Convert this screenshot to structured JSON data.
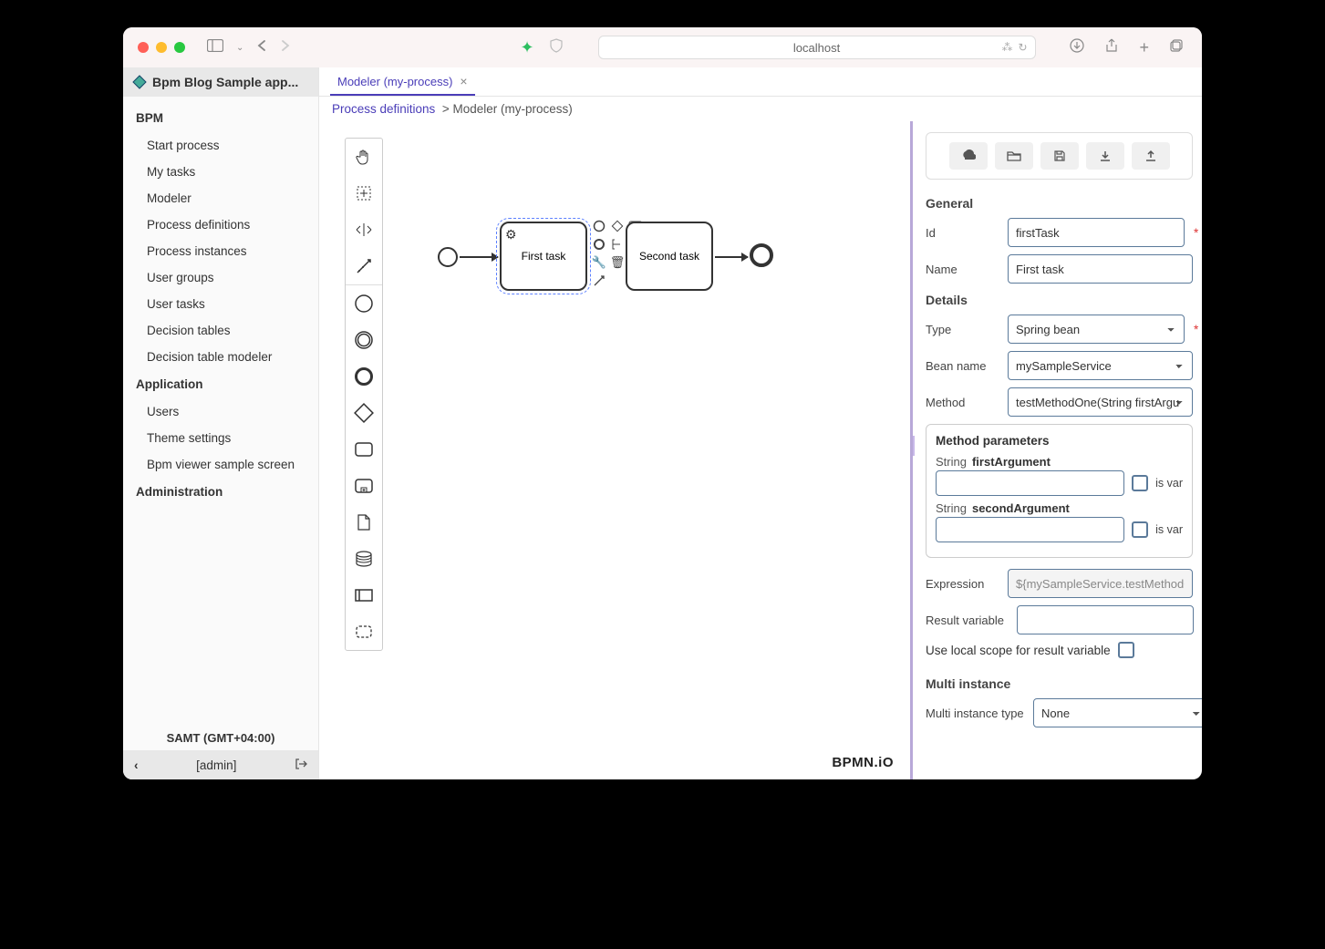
{
  "browser": {
    "address": "localhost"
  },
  "app_title": "Bpm Blog Sample app...",
  "sidebar": {
    "sections": [
      {
        "label": "BPM",
        "items": [
          "Start process",
          "My tasks",
          "Modeler",
          "Process definitions",
          "Process instances",
          "User groups",
          "User tasks",
          "Decision tables",
          "Decision table modeler"
        ]
      },
      {
        "label": "Application",
        "items": [
          "Users",
          "Theme settings",
          "Bpm viewer sample screen"
        ]
      },
      {
        "label": "Administration",
        "items": []
      }
    ],
    "timezone": "SAMT (GMT+04:00)",
    "user": "[admin]"
  },
  "tab": {
    "label": "Modeler (my-process)"
  },
  "breadcrumb": {
    "root": "Process definitions",
    "current": "Modeler (my-process)"
  },
  "diagram": {
    "task1": "First task",
    "task2": "Second task"
  },
  "bpmnio": "BPMN.iO",
  "props": {
    "general": {
      "title": "General",
      "id_label": "Id",
      "id_value": "firstTask",
      "name_label": "Name",
      "name_value": "First task"
    },
    "details": {
      "title": "Details",
      "type_label": "Type",
      "type_value": "Spring bean",
      "bean_label": "Bean name",
      "bean_value": "mySampleService",
      "method_label": "Method",
      "method_value": "testMethodOne(String firstArgu"
    },
    "params": {
      "title": "Method parameters",
      "p1_type": "String",
      "p1_name": "firstArgument",
      "p2_type": "String",
      "p2_name": "secondArgument",
      "isvar": "is var"
    },
    "expr_label": "Expression",
    "expr_value": "${mySampleService.testMethodO",
    "result_label": "Result variable",
    "localscope": "Use local scope for result variable",
    "multi": {
      "title": "Multi instance",
      "type_label": "Multi instance type",
      "type_value": "None"
    }
  }
}
